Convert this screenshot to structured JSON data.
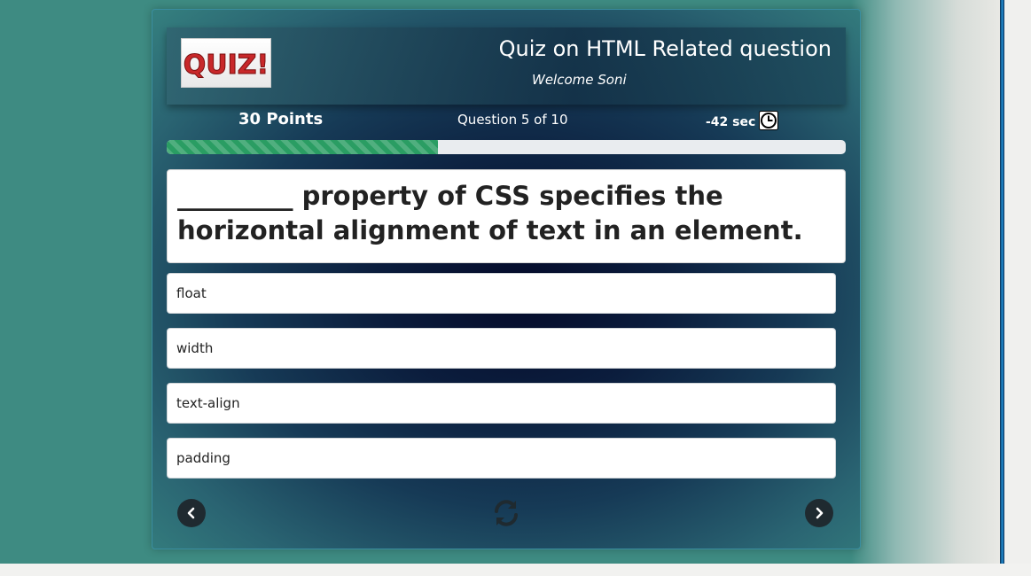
{
  "header": {
    "logo_text": "QUIZ!",
    "title": "Quiz on HTML Related question",
    "welcome": "Welcome Soni"
  },
  "stats": {
    "points": "30 Points",
    "question_counter": "Question 5 of 10",
    "timer": "-42 sec"
  },
  "progress": {
    "fraction": 0.4
  },
  "question": {
    "text": "_________ property of CSS specifies the horizontal alignment of text in an element."
  },
  "options": [
    "float",
    "width",
    "text-align",
    "padding"
  ],
  "icons": {
    "timer": "clock-icon",
    "prev": "chevron-left-icon",
    "refresh": "refresh-icon",
    "next": "chevron-right-icon"
  },
  "colors": {
    "page_background": "#3e8b82",
    "progress_fill": "#2a9d63",
    "nav_button": "#1f2a30"
  }
}
